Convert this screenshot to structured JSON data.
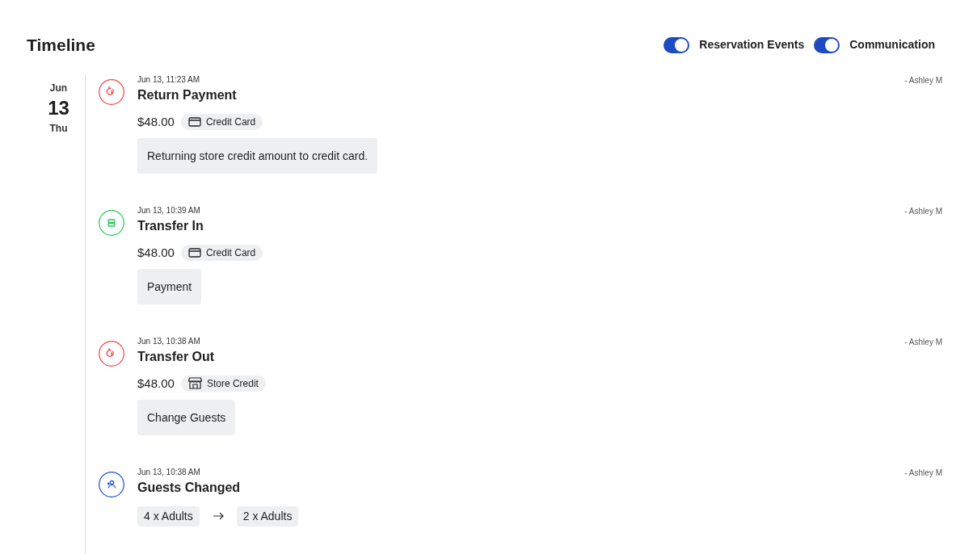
{
  "title": "Timeline",
  "toggles": [
    {
      "label": "Reservation Events",
      "on": true
    },
    {
      "label": "Communication",
      "on": true
    }
  ],
  "day": {
    "month": "Jun",
    "date": "13",
    "weekday": "Thu"
  },
  "events": [
    {
      "kind": "refund",
      "time": "Jun 13, 11:23 AM",
      "title": "Return Payment",
      "author": "- Ashley M",
      "amount": "$48.00",
      "method": {
        "kind": "card",
        "label": "Credit Card"
      },
      "note": "Returning store credit amount to credit card."
    },
    {
      "kind": "transfer",
      "time": "Jun 13, 10:39 AM",
      "title": "Transfer In",
      "author": "- Ashley M",
      "amount": "$48.00",
      "method": {
        "kind": "card",
        "label": "Credit Card"
      },
      "note": "Payment"
    },
    {
      "kind": "refund",
      "time": "Jun 13, 10:38 AM",
      "title": "Transfer Out",
      "author": "- Ashley M",
      "amount": "$48.00",
      "method": {
        "kind": "store",
        "label": "Store Credit"
      },
      "note": "Change Guests"
    },
    {
      "kind": "guests",
      "time": "Jun 13, 10:38 AM",
      "title": "Guests Changed",
      "author": "- Ashley M",
      "from": "4 x Adults",
      "to": "2 x Adults"
    }
  ]
}
